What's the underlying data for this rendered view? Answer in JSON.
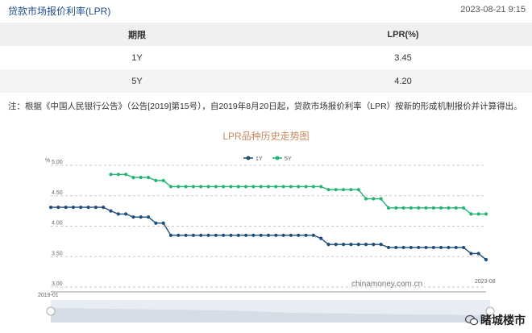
{
  "header": {
    "title": "贷款市场报价利率(LPR)",
    "timestamp": "2023-08-21 9:15"
  },
  "table": {
    "headers": [
      "期限",
      "LPR(%)"
    ],
    "rows": [
      {
        "term": "1Y",
        "rate": "3.45"
      },
      {
        "term": "5Y",
        "rate": "4.20"
      }
    ]
  },
  "note": "注：根据《中国人民银行公告》（公告[2019]第15号），自2019年8月20日起，贷款市场报价利率（LPR）按新的形成机制报价并计算得出。",
  "chart_title": "LPR品种历史走势图",
  "watermark": "chinamoney.com.cn",
  "brand": "睹城楼市",
  "chart_data": {
    "type": "line",
    "title": "LPR品种历史走势图",
    "ylabel": "%",
    "xlabel": "",
    "ylim": [
      3.0,
      5.0
    ],
    "yticks": [
      "5.00",
      "4.50",
      "4.00",
      "3.50",
      "3.00"
    ],
    "x_range_labels": [
      "2019-01",
      "2023-08"
    ],
    "grid": true,
    "legend": "top-center",
    "series": [
      {
        "name": "1Y",
        "color": "#1f4e79",
        "values": [
          4.31,
          4.31,
          4.31,
          4.31,
          4.31,
          4.31,
          4.31,
          4.31,
          4.25,
          4.2,
          4.2,
          4.15,
          4.15,
          4.15,
          4.05,
          4.05,
          3.85,
          3.85,
          3.85,
          3.85,
          3.85,
          3.85,
          3.85,
          3.85,
          3.85,
          3.85,
          3.85,
          3.85,
          3.85,
          3.85,
          3.85,
          3.85,
          3.85,
          3.85,
          3.85,
          3.85,
          3.8,
          3.7,
          3.7,
          3.7,
          3.7,
          3.7,
          3.7,
          3.7,
          3.7,
          3.65,
          3.65,
          3.65,
          3.65,
          3.65,
          3.65,
          3.65,
          3.65,
          3.65,
          3.65,
          3.65,
          3.55,
          3.55,
          3.45
        ]
      },
      {
        "name": "5Y",
        "color": "#22b573",
        "values": [
          null,
          null,
          null,
          null,
          null,
          null,
          null,
          null,
          4.85,
          4.85,
          4.85,
          4.8,
          4.8,
          4.8,
          4.75,
          4.75,
          4.65,
          4.65,
          4.65,
          4.65,
          4.65,
          4.65,
          4.65,
          4.65,
          4.65,
          4.65,
          4.65,
          4.65,
          4.65,
          4.65,
          4.65,
          4.65,
          4.65,
          4.65,
          4.65,
          4.65,
          4.65,
          4.6,
          4.6,
          4.6,
          4.6,
          4.6,
          4.45,
          4.45,
          4.45,
          4.3,
          4.3,
          4.3,
          4.3,
          4.3,
          4.3,
          4.3,
          4.3,
          4.3,
          4.3,
          4.3,
          4.2,
          4.2,
          4.2
        ]
      }
    ]
  }
}
